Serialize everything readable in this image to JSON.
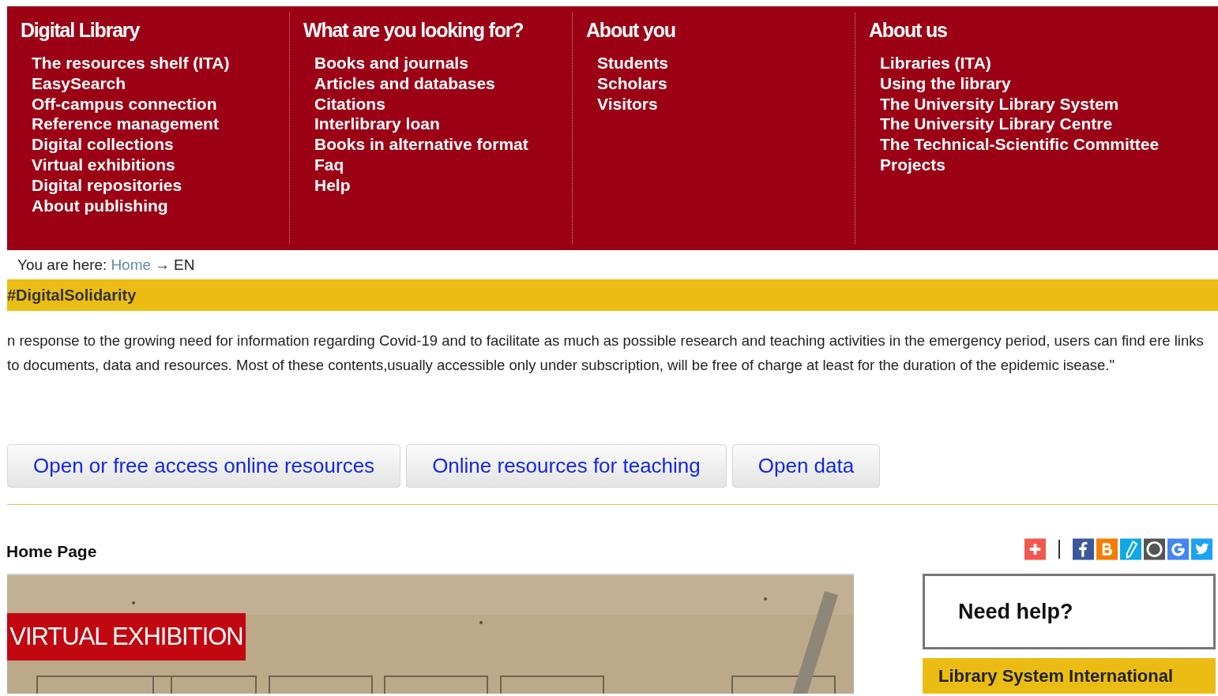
{
  "menu_columns": [
    {
      "title": "Digital Library",
      "items": [
        "The resources shelf (ITA)",
        "EasySearch",
        "Off-campus connection",
        "Reference management",
        "Digital collections",
        "Virtual exhibitions",
        "Digital repositories",
        "About publishing"
      ]
    },
    {
      "title": "What are you looking for?",
      "items": [
        "Books and journals",
        "Articles and databases",
        "Citations",
        "Interlibrary loan",
        "Books in alternative format",
        "Faq",
        "Help"
      ]
    },
    {
      "title": "About you",
      "items": [
        "Students",
        "Scholars",
        "Visitors"
      ]
    },
    {
      "title": "About us",
      "items": [
        "Libraries (ITA)",
        "Using the library",
        "The University Library System",
        "The University Library Centre",
        "The Technical-Scientific Committee",
        "Projects"
      ]
    }
  ],
  "breadcrumb": {
    "label": "You are here:",
    "link": "Home",
    "arrow": "→",
    "current": "EN"
  },
  "banner": "#DigitalSolidarity",
  "intro": "n response to the growing need for information regarding Covid-19 and to facilitate as much as possible research and teaching activities in the emergency period, users can find ere links to documents, data and resources. Most of these contents,usually accessible only under subscription, will be free of charge at least for the duration of the epidemic isease.\"",
  "buttons": [
    "Open or free access online resources",
    "Online resources for teaching",
    "Open data"
  ],
  "section_title": "Home Page",
  "share_icons": [
    {
      "kind": "plus",
      "color": "#f0584f"
    },
    {
      "kind": "divider"
    },
    {
      "kind": "f",
      "color": "#3b5998"
    },
    {
      "kind": "b",
      "color": "#f57d00"
    },
    {
      "kind": "pen",
      "color": "#0ea8e4"
    },
    {
      "kind": "w",
      "color": "#555555"
    },
    {
      "kind": "g",
      "color": "#4285f4"
    },
    {
      "kind": "bird",
      "color": "#1da1f2"
    }
  ],
  "feature": {
    "kind": "picture",
    "caption": "VIRTUAL EXHIBITION"
  },
  "help_box": {
    "title": "Need help?"
  },
  "sidebar_banner": "Library System International"
}
